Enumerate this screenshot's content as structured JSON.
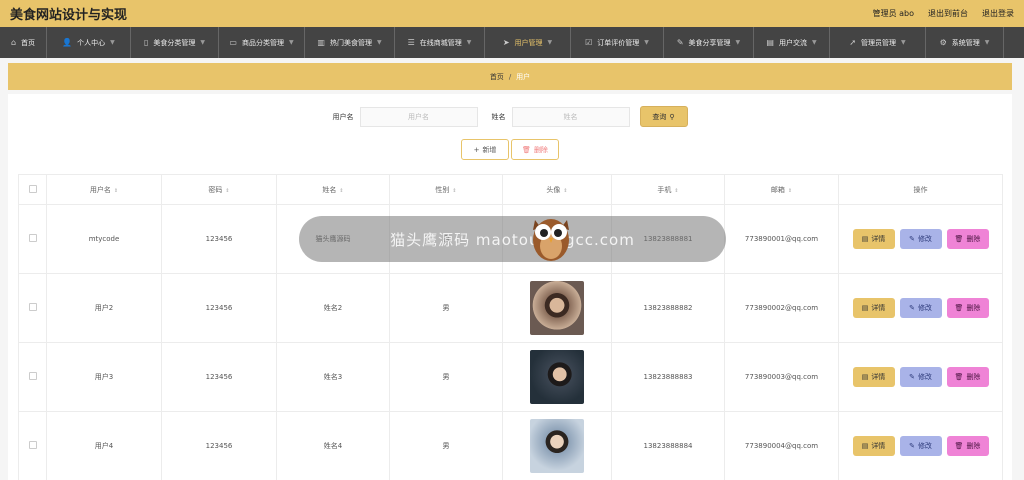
{
  "header": {
    "title": "美食网站设计与实现",
    "admin_label": "管理员 abo",
    "frontend_link": "退出到前台",
    "logout_link": "退出登录"
  },
  "nav": {
    "items": [
      {
        "label": "首页",
        "icon": "home-icon",
        "glyph": "⌂",
        "has_arrow": false,
        "active": false
      },
      {
        "label": "个人中心",
        "icon": "user-icon",
        "glyph": "👤",
        "has_arrow": true,
        "active": false
      },
      {
        "label": "美食分类管理",
        "icon": "phone-icon",
        "glyph": "▯",
        "has_arrow": true,
        "active": false
      },
      {
        "label": "商品分类管理",
        "icon": "monitor-icon",
        "glyph": "▭",
        "has_arrow": true,
        "active": false
      },
      {
        "label": "热门美食管理",
        "icon": "book-icon",
        "glyph": "▥",
        "has_arrow": true,
        "active": false
      },
      {
        "label": "在线商城管理",
        "icon": "list-icon",
        "glyph": "☰",
        "has_arrow": true,
        "active": false
      },
      {
        "label": "用户管理",
        "icon": "send-icon",
        "glyph": "➤",
        "has_arrow": true,
        "active": true
      },
      {
        "label": "订单评价管理",
        "icon": "check-square-icon",
        "glyph": "☑",
        "has_arrow": true,
        "active": false
      },
      {
        "label": "美食分享管理",
        "icon": "paint-icon",
        "glyph": "✎",
        "has_arrow": true,
        "active": false
      },
      {
        "label": "用户交流",
        "icon": "chat-icon",
        "glyph": "▤",
        "has_arrow": true,
        "active": false
      },
      {
        "label": "管理员管理",
        "icon": "navigate-icon",
        "glyph": "➚",
        "has_arrow": true,
        "active": false
      },
      {
        "label": "系统管理",
        "icon": "settings-icon",
        "glyph": "⚙",
        "has_arrow": true,
        "active": false
      }
    ]
  },
  "breadcrumb": {
    "home": "首页",
    "separator": "/",
    "current": "用户"
  },
  "search": {
    "username_label": "用户名",
    "username_placeholder": "用户名",
    "name_label": "姓名",
    "name_placeholder": "姓名",
    "query_button": "查询"
  },
  "actions": {
    "add_label": "新增",
    "delete_label": "删除"
  },
  "table": {
    "columns": [
      "用户名",
      "密码",
      "姓名",
      "性别",
      "头像",
      "手机",
      "邮箱",
      "操作"
    ],
    "sortable": [
      true,
      true,
      true,
      true,
      true,
      true,
      true,
      false
    ],
    "rows": [
      {
        "username": "mtycode",
        "password": "123456",
        "name": "猫头鹰源码",
        "gender": "男",
        "avatar": "av0",
        "phone": "13823888881",
        "email": "773890001@qq.com"
      },
      {
        "username": "用户2",
        "password": "123456",
        "name": "姓名2",
        "gender": "男",
        "avatar": "av1",
        "phone": "13823888882",
        "email": "773890002@qq.com"
      },
      {
        "username": "用户3",
        "password": "123456",
        "name": "姓名3",
        "gender": "男",
        "avatar": "av2",
        "phone": "13823888883",
        "email": "773890003@qq.com"
      },
      {
        "username": "用户4",
        "password": "123456",
        "name": "姓名4",
        "gender": "男",
        "avatar": "av3",
        "phone": "13823888884",
        "email": "773890004@qq.com"
      }
    ],
    "row_actions": {
      "detail": "详情",
      "edit": "修改",
      "delete": "删除"
    }
  },
  "watermark": {
    "text": "猫头鹰源码 maotouyingcc.com"
  },
  "colors": {
    "accent": "#e8c46a",
    "nav_bg": "#444444",
    "edit": "#a9b3e8",
    "delete": "#ef83d6"
  }
}
